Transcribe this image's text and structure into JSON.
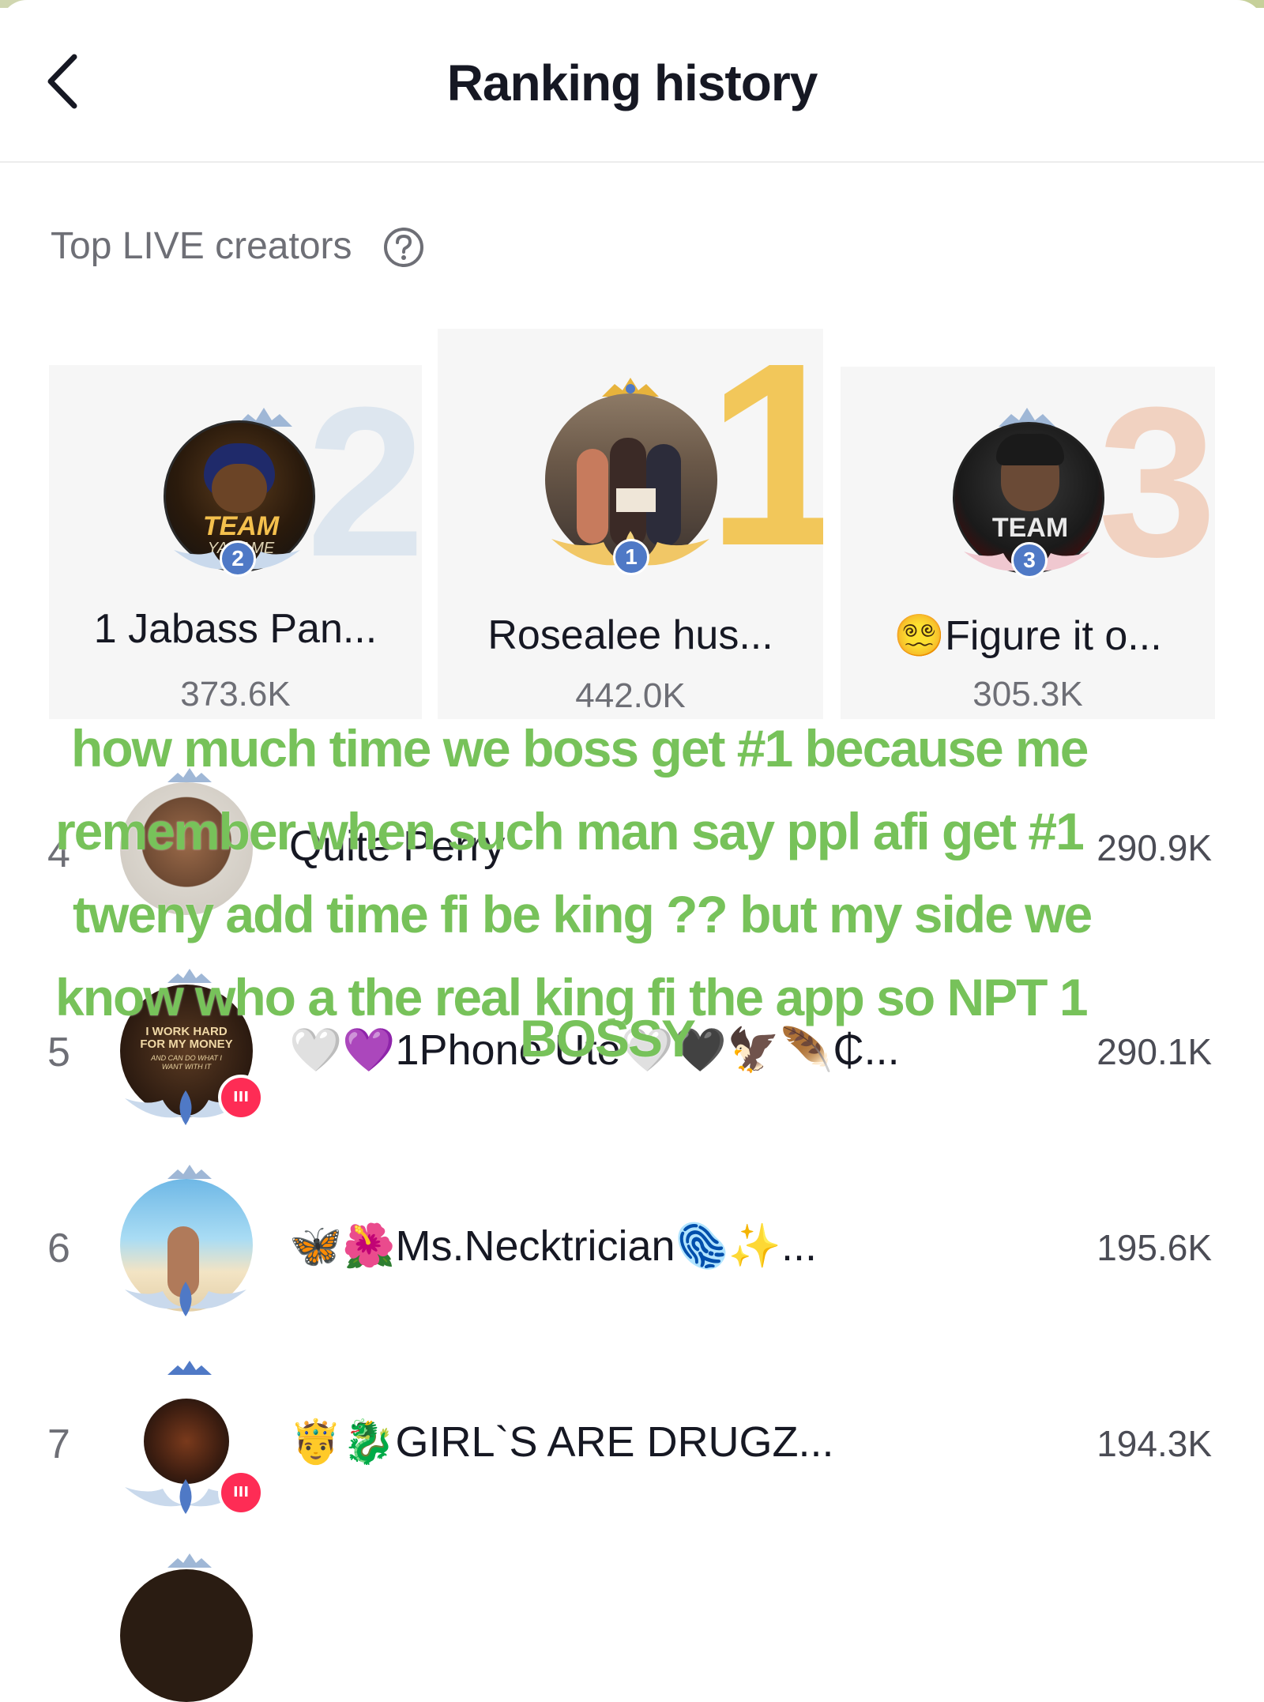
{
  "header": {
    "title": "Ranking history"
  },
  "section": {
    "label": "Top LIVE creators"
  },
  "podium": [
    {
      "rank": "2",
      "name": "1 Jabass Pan...",
      "score": "373.6K"
    },
    {
      "rank": "1",
      "name": "Rosealee hus...",
      "score": "442.0K"
    },
    {
      "rank": "3",
      "name": "😵‍💫Figure  it  o...",
      "score": "305.3K"
    }
  ],
  "rows": [
    {
      "rank": "4",
      "name": "Quite Perry",
      "score": "290.9K"
    },
    {
      "rank": "5",
      "name": "🤍💜1Phone Ute🤍🖤🦅🪶₵...",
      "score": "290.1K"
    },
    {
      "rank": "6",
      "name": "🦋🌺Ms.Necktrician🫆✨...",
      "score": "195.6K"
    },
    {
      "rank": "7",
      "name": "🤴🐉GIRL`S ARE DRUGZ...",
      "score": "194.3K"
    }
  ],
  "avatar_text": {
    "p2": "TEAM",
    "p2b": "YA TAME",
    "p3": "TEAM",
    "r5": "I WORK HARD FOR MY MONEY",
    "r5b": "AND CAN DO WHAT I WANT WITH IT"
  },
  "caption": {
    "line1": "how much time we boss get #1 because me",
    "line2": "remember when such man say ppl afi get #1",
    "line3": "tweny add time fi be king ?? but my side we",
    "line4": "know who a the real king fi the app so NPT 1",
    "line5": "BOSSY"
  },
  "colors": {
    "caption": "#77c25a",
    "gold": "#f0c24a",
    "silver": "#dde6ef",
    "bronze": "#f2d3c2",
    "live": "#fe2c55"
  }
}
